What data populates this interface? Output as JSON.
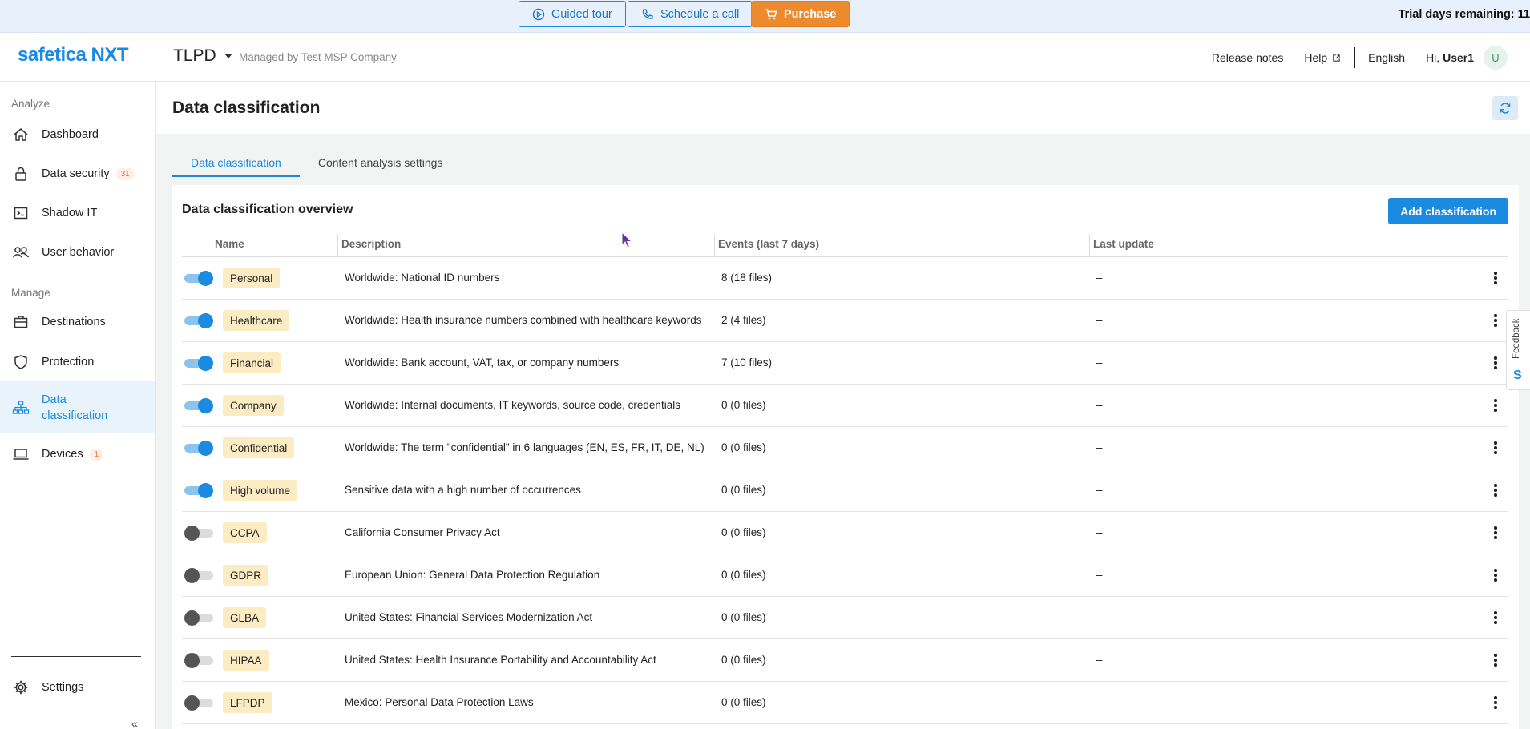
{
  "topbar": {
    "guided_tour": "Guided tour",
    "schedule_call": "Schedule a call",
    "purchase": "Purchase",
    "trial_text": "Trial days remaining: 11"
  },
  "header": {
    "logo": "safetica NXT",
    "tenant": "TLPD",
    "managed_by": "Managed by Test MSP Company",
    "release_notes": "Release notes",
    "help": "Help",
    "language": "English",
    "greeting": "Hi,",
    "user": "User1",
    "avatar_initial": "U"
  },
  "sidebar": {
    "analyze_label": "Analyze",
    "manage_label": "Manage",
    "items": [
      {
        "label": "Dashboard",
        "icon": "home-icon"
      },
      {
        "label": "Data security",
        "icon": "lock-icon",
        "badge": "31"
      },
      {
        "label": "Shadow IT",
        "icon": "terminal-icon"
      },
      {
        "label": "User behavior",
        "icon": "users-icon"
      },
      {
        "label": "Destinations",
        "icon": "briefcase-icon"
      },
      {
        "label": "Protection",
        "icon": "shield-icon"
      },
      {
        "label": "Data\nclassification",
        "icon": "hierarchy-icon"
      },
      {
        "label": "Devices",
        "icon": "laptop-icon",
        "badge": "1"
      },
      {
        "label": "Settings",
        "icon": "gear-icon"
      }
    ],
    "collapse_glyph": "«"
  },
  "page": {
    "title": "Data classification",
    "tabs": [
      "Data classification",
      "Content analysis settings"
    ],
    "card_title": "Data classification overview",
    "add_button": "Add classification",
    "feedback": "Feedback"
  },
  "table": {
    "headers": [
      "Name",
      "Description",
      "Events (last 7 days)",
      "Last update"
    ],
    "rows": [
      {
        "enabled": true,
        "name": "Personal",
        "description": "Worldwide: National ID numbers",
        "events": "8 (18 files)",
        "last_update": "–"
      },
      {
        "enabled": true,
        "name": "Healthcare",
        "description": "Worldwide: Health insurance numbers combined with healthcare keywords",
        "events": "2 (4 files)",
        "last_update": "–"
      },
      {
        "enabled": true,
        "name": "Financial",
        "description": "Worldwide: Bank account, VAT, tax, or company numbers",
        "events": "7 (10 files)",
        "last_update": "–"
      },
      {
        "enabled": true,
        "name": "Company",
        "description": "Worldwide: Internal documents, IT keywords, source code, credentials",
        "events": "0 (0 files)",
        "last_update": "–"
      },
      {
        "enabled": true,
        "name": "Confidential",
        "description": "Worldwide: The term \"confidential\" in 6 languages (EN, ES, FR, IT, DE, NL)",
        "events": "0 (0 files)",
        "last_update": "–"
      },
      {
        "enabled": true,
        "name": "High volume",
        "description": "Sensitive data with a high number of occurrences",
        "events": "0 (0 files)",
        "last_update": "–"
      },
      {
        "enabled": false,
        "name": "CCPA",
        "description": "California Consumer Privacy Act",
        "events": "0 (0 files)",
        "last_update": "–"
      },
      {
        "enabled": false,
        "name": "GDPR",
        "description": "European Union: General Data Protection Regulation",
        "events": "0 (0 files)",
        "last_update": "–"
      },
      {
        "enabled": false,
        "name": "GLBA",
        "description": "United States: Financial Services Modernization Act",
        "events": "0 (0 files)",
        "last_update": "–"
      },
      {
        "enabled": false,
        "name": "HIPAA",
        "description": "United States: Health Insurance Portability and Accountability Act",
        "events": "0 (0 files)",
        "last_update": "–"
      },
      {
        "enabled": false,
        "name": "LFPDP",
        "description": "Mexico: Personal Data Protection Laws",
        "events": "0 (0 files)",
        "last_update": "–"
      }
    ]
  },
  "colors": {
    "accent": "#1a8be0",
    "purchase": "#ee8a2e",
    "tag_bg": "#fbecc4",
    "topbar_bg": "#e8f0fb"
  }
}
